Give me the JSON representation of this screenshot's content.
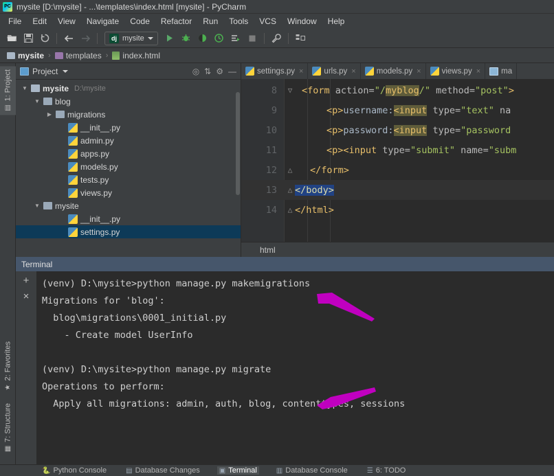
{
  "window": {
    "title": "mysite [D:\\mysite] - ...\\templates\\index.html [mysite] - PyCharm",
    "logo_text": "PC"
  },
  "menubar": {
    "items": [
      "File",
      "Edit",
      "View",
      "Navigate",
      "Code",
      "Refactor",
      "Run",
      "Tools",
      "VCS",
      "Window",
      "Help"
    ]
  },
  "toolbar": {
    "open_icon": "open-folder-icon",
    "save_icon": "save-icon",
    "sync_icon": "sync-icon",
    "back_icon": "navigate-back-icon",
    "forward_icon": "navigate-forward-icon",
    "run_config_badge": "dj",
    "run_config_name": "mysite",
    "run_icon": "run-icon",
    "debug_icon": "debug-icon",
    "coverage_icon": "run-with-coverage-icon",
    "profile_icon": "profile-icon",
    "attach_icon": "run-task-icon",
    "stop_icon": "stop-icon",
    "settings_icon": "wrench-settings-icon",
    "structure_icon": "project-structure-icon"
  },
  "breadcrumb": {
    "items": [
      {
        "label": "mysite",
        "icon": "folder-icon"
      },
      {
        "label": "templates",
        "icon": "folder-icon-purple"
      },
      {
        "label": "index.html",
        "icon": "html-file-icon"
      }
    ],
    "separator": "›"
  },
  "left_rail": {
    "tabs": [
      {
        "label": "1: Project",
        "selected": true,
        "icon": "project-icon"
      },
      {
        "label": "2: Favorites",
        "selected": false,
        "icon": "star-icon"
      },
      {
        "label": "7: Structure",
        "selected": false,
        "icon": "structure-icon"
      }
    ]
  },
  "project_panel": {
    "title": "Project",
    "dropdown_icon": "chevron-down-icon",
    "tools": [
      "collapse-target-icon",
      "expand-collapse-icon",
      "gear-icon",
      "minimize-icon"
    ],
    "tree": [
      {
        "depth": 0,
        "arrow": "▼",
        "icon": "folder-icon",
        "label": "mysite",
        "path": "D:\\mysite",
        "bold": true,
        "selected": false
      },
      {
        "depth": 1,
        "arrow": "▼",
        "icon": "module-folder-icon",
        "label": "blog",
        "path": "",
        "bold": false,
        "selected": false
      },
      {
        "depth": 2,
        "arrow": "▶",
        "icon": "module-folder-icon",
        "label": "migrations",
        "path": "",
        "bold": false,
        "selected": false
      },
      {
        "depth": 3,
        "arrow": "",
        "icon": "python-file-icon",
        "label": "__init__.py",
        "path": "",
        "bold": false,
        "selected": false
      },
      {
        "depth": 3,
        "arrow": "",
        "icon": "python-file-icon",
        "label": "admin.py",
        "path": "",
        "bold": false,
        "selected": false
      },
      {
        "depth": 3,
        "arrow": "",
        "icon": "python-file-icon",
        "label": "apps.py",
        "path": "",
        "bold": false,
        "selected": false
      },
      {
        "depth": 3,
        "arrow": "",
        "icon": "python-file-icon",
        "label": "models.py",
        "path": "",
        "bold": false,
        "selected": false
      },
      {
        "depth": 3,
        "arrow": "",
        "icon": "python-file-icon",
        "label": "tests.py",
        "path": "",
        "bold": false,
        "selected": false
      },
      {
        "depth": 3,
        "arrow": "",
        "icon": "python-file-icon",
        "label": "views.py",
        "path": "",
        "bold": false,
        "selected": false
      },
      {
        "depth": 1,
        "arrow": "▼",
        "icon": "module-folder-icon",
        "label": "mysite",
        "path": "",
        "bold": false,
        "selected": false
      },
      {
        "depth": 3,
        "arrow": "",
        "icon": "python-file-icon",
        "label": "__init__.py",
        "path": "",
        "bold": false,
        "selected": false
      },
      {
        "depth": 3,
        "arrow": "",
        "icon": "python-file-icon",
        "label": "settings.py",
        "path": "",
        "bold": false,
        "selected": true
      }
    ]
  },
  "editor": {
    "tabs": [
      {
        "label": "settings.py",
        "icon": "python-file-icon",
        "close": "×",
        "active": false
      },
      {
        "label": "urls.py",
        "icon": "python-file-icon",
        "close": "×",
        "active": false
      },
      {
        "label": "models.py",
        "icon": "python-file-icon",
        "close": "×",
        "active": false
      },
      {
        "label": "views.py",
        "icon": "python-file-icon",
        "close": "×",
        "active": false
      },
      {
        "label": "ma",
        "icon": "table-icon",
        "close": "",
        "active": false
      }
    ],
    "lines": [
      {
        "num": "8",
        "fold": "▽",
        "highlight": false
      },
      {
        "num": "9",
        "fold": "",
        "highlight": false
      },
      {
        "num": "10",
        "fold": "",
        "highlight": false
      },
      {
        "num": "11",
        "fold": "",
        "highlight": false
      },
      {
        "num": "12",
        "fold": "△",
        "highlight": false
      },
      {
        "num": "13",
        "fold": "△",
        "highlight": true
      },
      {
        "num": "14",
        "fold": "△",
        "highlight": false
      }
    ],
    "code_text": [
      "<form action=\"/myblog/\" method=\"post\">",
      "  <p>username:<input type=\"text\" name=",
      "  <p>password:<input type=\"password\"",
      "  <p><input type=\"submit\" name=\"subm",
      "</form>",
      "</body>",
      "</html>"
    ],
    "breadcrumb_label": "html"
  },
  "terminal": {
    "title": "Terminal",
    "add_icon": "+",
    "close_icon": "×",
    "output": "(venv) D:\\mysite>python manage.py makemigrations\nMigrations for 'blog':\n  blog\\migrations\\0001_initial.py\n    - Create model UserInfo\n\n(venv) D:\\mysite>python manage.py migrate\nOperations to perform:\n  Apply all migrations: admin, auth, blog, contenttypes, sessions"
  },
  "annotations": {
    "arrow_color": "#c000c0",
    "arrow_count": 2
  },
  "statusbar": {
    "items": [
      {
        "label": "Python Console",
        "icon": "python-console-icon",
        "selected": false
      },
      {
        "label": "Database Changes",
        "icon": "database-changes-icon",
        "selected": false
      },
      {
        "label": "Terminal",
        "icon": "terminal-icon",
        "selected": true
      },
      {
        "label": "Database Console",
        "icon": "database-console-icon",
        "selected": false
      },
      {
        "label": "6: TODO",
        "icon": "todo-icon",
        "selected": false
      }
    ]
  },
  "colors": {
    "bg_chrome": "#3c3f41",
    "bg_editor": "#2b2b2b",
    "selection_blue": "#0d3a58",
    "terminal_header": "#46566b",
    "accent_green": "#59a869"
  }
}
